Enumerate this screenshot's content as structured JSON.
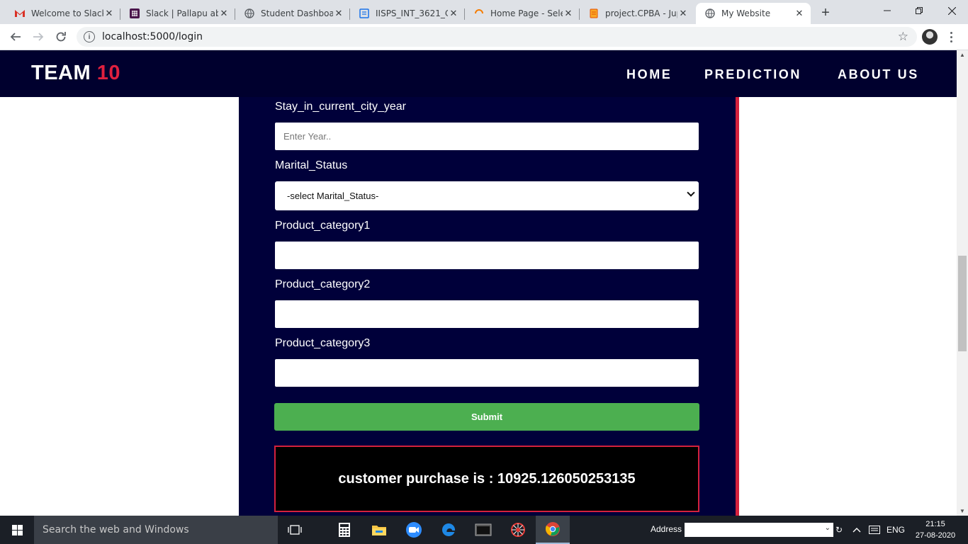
{
  "browser": {
    "tabs": [
      {
        "title": "Welcome to Slack!",
        "icon": "gmail-icon",
        "active": false
      },
      {
        "title": "Slack | Pallapu abh",
        "icon": "slack-icon",
        "active": false
      },
      {
        "title": "Student Dashboard",
        "icon": "globe-icon",
        "active": false
      },
      {
        "title": "IISPS_INT_3621_Co",
        "icon": "doc-icon",
        "active": false
      },
      {
        "title": "Home Page - Selec",
        "icon": "loading-icon",
        "active": false
      },
      {
        "title": "project.CPBA - Jup",
        "icon": "notebook-icon",
        "active": false
      },
      {
        "title": "My Website",
        "icon": "globe-icon",
        "active": true
      }
    ],
    "new_tab": "+",
    "url": "localhost:5000/login"
  },
  "site": {
    "brand": "TEAM",
    "brand_number": "10",
    "nav": [
      "HOME",
      "PREDICTION",
      "ABOUT US"
    ],
    "form": {
      "stay_label": "Stay_in_current_city_year",
      "stay_placeholder": "Enter Year..",
      "marital_label": "Marital_Status",
      "marital_selected": "-select Marital_Status-",
      "pc1_label": "Product_category1",
      "pc2_label": "Product_category2",
      "pc3_label": "Product_category3",
      "submit_label": "Submit"
    },
    "result_text": "customer purchase is : 10925.126050253135"
  },
  "taskbar": {
    "search_placeholder": "Search the web and Windows",
    "address_label": "Address",
    "language": "ENG",
    "time": "21:15",
    "date": "27-08-2020"
  },
  "colors": {
    "nav_bg": "#00002e",
    "panel_bg": "#00003a",
    "accent_red": "#d4213d",
    "submit_green": "#4caf50"
  }
}
